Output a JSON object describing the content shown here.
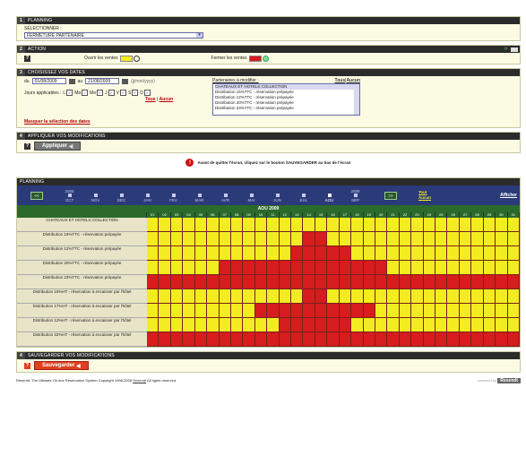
{
  "sec1": {
    "num": "1",
    "title": "PLANNING",
    "sel_label": "SÉLECTIONNER :",
    "selected": "FERMETURE PARTENAIRE"
  },
  "sec2": {
    "num": "2",
    "title": "ACTION",
    "open_label": "Ouvrir les ventes",
    "close_label": "Fermer les ventes",
    "colors": {
      "open": "#f2ec20",
      "close": "#d61c1c"
    }
  },
  "sec3": {
    "num": "3",
    "title": "CHOISISSEZ VOS DATES",
    "du": "du",
    "au": "au",
    "date_from": "01/08/2009",
    "date_to": "21/08/2009",
    "date_fmt": "(jj/mm/yyyy)",
    "days_label": "Jours applicables :",
    "days": [
      "L",
      "Ma",
      "Me",
      "J",
      "V",
      "S",
      "D"
    ],
    "tous": "Tous",
    "aucun": "Aucun",
    "sep": "|",
    "partners_label": "Partenaires à modifier :",
    "partners": [
      "CHATEAUX ET HOTELS COLLECTION",
      "Distribution 15%TTC - réservation prépayée",
      "Distribution 12%TTC - réservation prépayée",
      "Distribution 20%TTC - réservation prépayée",
      "Distribution 23%TTC - réservation prépayée"
    ],
    "hide_link": "Masquer la sélection des dates"
  },
  "sec4": {
    "num": "4",
    "title": "APPLIQUER VOS MODIFICATIONS",
    "apply": "Appliquer"
  },
  "warning": "Avant de quitter l'écran, cliquez sur le bouton SAUVEGARDER au bas de l'écran",
  "planning": {
    "title": "PLANNING",
    "prev": "<<",
    "next": ">>",
    "year_left": "2008",
    "year_right": "2009",
    "months": [
      "OCT",
      "NOV",
      "DEC",
      "JAN",
      "FEV",
      "MAR",
      "AVR",
      "MAI",
      "JUN",
      "JUIL",
      "AOU",
      "SEP"
    ],
    "tout": "Tout",
    "aucun": "Aucun",
    "afficher": "Afficher",
    "month_title": "AOU 2009",
    "days": [
      "01",
      "02",
      "03",
      "04",
      "05",
      "06",
      "07",
      "08",
      "09",
      "10",
      "11",
      "12",
      "13",
      "14",
      "15",
      "16",
      "17",
      "18",
      "19",
      "20",
      "21",
      "22",
      "23",
      "24",
      "25",
      "26",
      "27",
      "28",
      "29",
      "30",
      "31"
    ],
    "rows": [
      {
        "label": "CHATEAUX ET HOTELS COLLECTION",
        "red": []
      },
      {
        "label": "Distribution 15%TTC - réservation prépayée",
        "red": [
          14,
          15
        ]
      },
      {
        "label": "Distribution 12%TTC - réservation prépayée",
        "red": [
          13,
          14,
          15,
          16,
          17
        ]
      },
      {
        "label": "Distribution 20%TTC - réservation prépayée",
        "red": [
          7,
          8,
          9,
          10,
          11,
          12,
          13,
          14,
          15,
          16,
          17,
          18,
          19,
          20
        ]
      },
      {
        "label": "Distribution 23%TTC - réservation prépayée",
        "red": [
          1,
          2,
          3,
          4,
          5,
          6,
          7,
          8,
          9,
          10,
          11,
          12,
          13,
          14,
          15,
          16,
          17,
          18,
          19,
          20,
          21,
          22,
          23,
          24,
          25,
          26,
          27,
          28,
          29,
          30,
          31
        ]
      },
      {
        "label": "Distribution 15%HT - réservation à encaisser par l'hôtel",
        "red": [
          14,
          15
        ]
      },
      {
        "label": "Distribution 17%HT - réservation à encaisser par l'hôtel",
        "red": [
          10,
          11,
          12,
          13,
          14,
          15,
          16,
          17,
          18,
          19
        ]
      },
      {
        "label": "Distribution 12%HT - réservation à encaisser par l'hôtel",
        "red": [
          12,
          13,
          14,
          15,
          16,
          17
        ]
      },
      {
        "label": "Distribution 22%HT - réservation à encaisser par l'hôtel",
        "red": [
          1,
          2,
          3,
          4,
          5,
          6,
          7,
          8,
          9,
          10,
          11,
          12,
          13,
          14,
          15,
          16,
          17,
          18,
          19,
          20,
          21,
          22,
          23,
          24,
          25,
          26,
          27,
          28,
          29,
          30,
          31
        ]
      }
    ]
  },
  "sec5": {
    "num": "4",
    "title": "SAUVEGARDER VOS MODIFICATIONS",
    "save": "Sauvegarder"
  },
  "footer": {
    "left": "Resendt. The Ultimate On-line Reservation System Copyright 1998-2008",
    "brand": "Resendt",
    "rights": "All rights reserved.",
    "powered": "powered by",
    "logo": "Resendt"
  }
}
